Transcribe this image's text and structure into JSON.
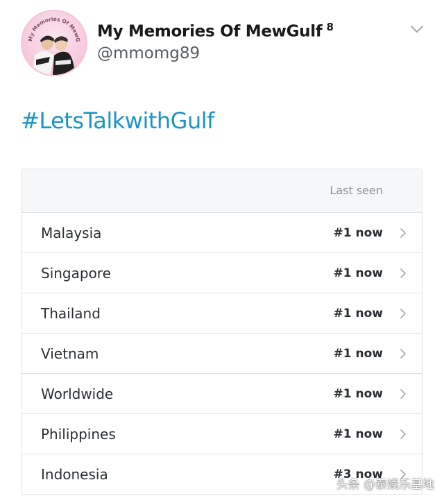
{
  "profile": {
    "display_name": "My Memories Of MewGulf",
    "badge": "8",
    "handle": "@mmomg89",
    "avatar_ring_text": "My Memories Of MewGulf"
  },
  "tweet": {
    "hashtag": "#LetsTalkwithGulf"
  },
  "trends": {
    "column_label": "Last seen",
    "rows": [
      {
        "country": "Malaysia",
        "rank": "#1 now"
      },
      {
        "country": "Singapore",
        "rank": "#1 now"
      },
      {
        "country": "Thailand",
        "rank": "#1 now"
      },
      {
        "country": "Vietnam",
        "rank": "#1 now"
      },
      {
        "country": "Worldwide",
        "rank": "#1 now"
      },
      {
        "country": "Philippines",
        "rank": "#1 now"
      },
      {
        "country": "Indonesia",
        "rank": "#3 now"
      }
    ]
  },
  "watermark": "头条 @泰娱乐基地",
  "colors": {
    "hashtag": "#1b95c7",
    "header_bg": "#f5f7f8",
    "text": "#2a2e33",
    "muted": "#8a9096"
  },
  "icons": {
    "menu": "chevron-down-icon",
    "row": "chevron-right-icon"
  }
}
